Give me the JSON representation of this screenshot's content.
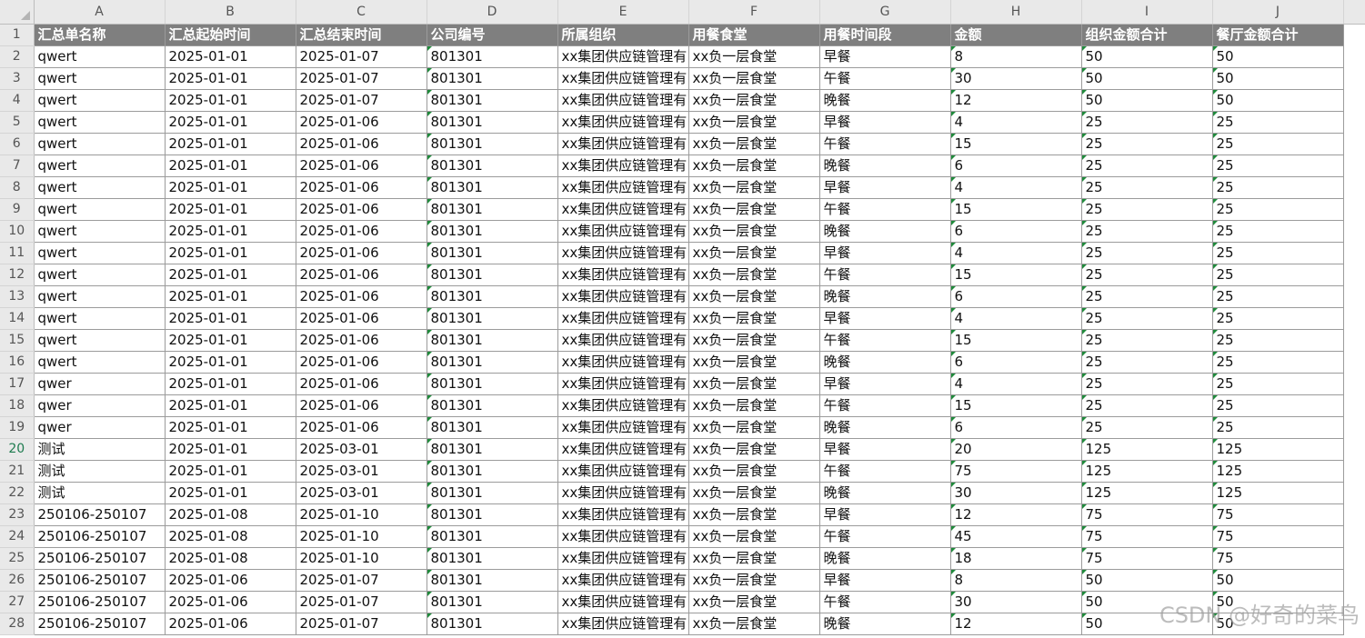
{
  "columns": [
    "A",
    "B",
    "C",
    "D",
    "E",
    "F",
    "G",
    "H",
    "I",
    "J"
  ],
  "headers": [
    "汇总单名称",
    "汇总起始时间",
    "汇总结束时间",
    "公司编号",
    "所属组织",
    "用餐食堂",
    "用餐时间段",
    "金额",
    "组织金额合计",
    "餐厅金额合计"
  ],
  "rows": [
    [
      "qwert",
      "2025-01-01",
      "2025-01-07",
      "801301",
      "xx集团供应链管理有",
      "xx负一层食堂",
      "早餐",
      "8",
      "50",
      "50"
    ],
    [
      "qwert",
      "2025-01-01",
      "2025-01-07",
      "801301",
      "xx集团供应链管理有",
      "xx负一层食堂",
      "午餐",
      "30",
      "50",
      "50"
    ],
    [
      "qwert",
      "2025-01-01",
      "2025-01-07",
      "801301",
      "xx集团供应链管理有",
      "xx负一层食堂",
      "晚餐",
      "12",
      "50",
      "50"
    ],
    [
      "qwert",
      "2025-01-01",
      "2025-01-06",
      "801301",
      "xx集团供应链管理有",
      "xx负一层食堂",
      "早餐",
      "4",
      "25",
      "25"
    ],
    [
      "qwert",
      "2025-01-01",
      "2025-01-06",
      "801301",
      "xx集团供应链管理有",
      "xx负一层食堂",
      "午餐",
      "15",
      "25",
      "25"
    ],
    [
      "qwert",
      "2025-01-01",
      "2025-01-06",
      "801301",
      "xx集团供应链管理有",
      "xx负一层食堂",
      "晚餐",
      "6",
      "25",
      "25"
    ],
    [
      "qwert",
      "2025-01-01",
      "2025-01-06",
      "801301",
      "xx集团供应链管理有",
      "xx负一层食堂",
      "早餐",
      "4",
      "25",
      "25"
    ],
    [
      "qwert",
      "2025-01-01",
      "2025-01-06",
      "801301",
      "xx集团供应链管理有",
      "xx负一层食堂",
      "午餐",
      "15",
      "25",
      "25"
    ],
    [
      "qwert",
      "2025-01-01",
      "2025-01-06",
      "801301",
      "xx集团供应链管理有",
      "xx负一层食堂",
      "晚餐",
      "6",
      "25",
      "25"
    ],
    [
      "qwert",
      "2025-01-01",
      "2025-01-06",
      "801301",
      "xx集团供应链管理有",
      "xx负一层食堂",
      "早餐",
      "4",
      "25",
      "25"
    ],
    [
      "qwert",
      "2025-01-01",
      "2025-01-06",
      "801301",
      "xx集团供应链管理有",
      "xx负一层食堂",
      "午餐",
      "15",
      "25",
      "25"
    ],
    [
      "qwert",
      "2025-01-01",
      "2025-01-06",
      "801301",
      "xx集团供应链管理有",
      "xx负一层食堂",
      "晚餐",
      "6",
      "25",
      "25"
    ],
    [
      "qwert",
      "2025-01-01",
      "2025-01-06",
      "801301",
      "xx集团供应链管理有",
      "xx负一层食堂",
      "早餐",
      "4",
      "25",
      "25"
    ],
    [
      "qwert",
      "2025-01-01",
      "2025-01-06",
      "801301",
      "xx集团供应链管理有",
      "xx负一层食堂",
      "午餐",
      "15",
      "25",
      "25"
    ],
    [
      "qwert",
      "2025-01-01",
      "2025-01-06",
      "801301",
      "xx集团供应链管理有",
      "xx负一层食堂",
      "晚餐",
      "6",
      "25",
      "25"
    ],
    [
      "qwer",
      "2025-01-01",
      "2025-01-06",
      "801301",
      "xx集团供应链管理有",
      "xx负一层食堂",
      "早餐",
      "4",
      "25",
      "25"
    ],
    [
      "qwer",
      "2025-01-01",
      "2025-01-06",
      "801301",
      "xx集团供应链管理有",
      "xx负一层食堂",
      "午餐",
      "15",
      "25",
      "25"
    ],
    [
      "qwer",
      "2025-01-01",
      "2025-01-06",
      "801301",
      "xx集团供应链管理有",
      "xx负一层食堂",
      "晚餐",
      "6",
      "25",
      "25"
    ],
    [
      "测试",
      "2025-01-01",
      "2025-03-01",
      "801301",
      "xx集团供应链管理有",
      "xx负一层食堂",
      "早餐",
      "20",
      "125",
      "125"
    ],
    [
      "测试",
      "2025-01-01",
      "2025-03-01",
      "801301",
      "xx集团供应链管理有",
      "xx负一层食堂",
      "午餐",
      "75",
      "125",
      "125"
    ],
    [
      "测试",
      "2025-01-01",
      "2025-03-01",
      "801301",
      "xx集团供应链管理有",
      "xx负一层食堂",
      "晚餐",
      "30",
      "125",
      "125"
    ],
    [
      "250106-250107",
      "2025-01-08",
      "2025-01-10",
      "801301",
      "xx集团供应链管理有",
      "xx负一层食堂",
      "早餐",
      "12",
      "75",
      "75"
    ],
    [
      "250106-250107",
      "2025-01-08",
      "2025-01-10",
      "801301",
      "xx集团供应链管理有",
      "xx负一层食堂",
      "午餐",
      "45",
      "75",
      "75"
    ],
    [
      "250106-250107",
      "2025-01-08",
      "2025-01-10",
      "801301",
      "xx集团供应链管理有",
      "xx负一层食堂",
      "晚餐",
      "18",
      "75",
      "75"
    ],
    [
      "250106-250107",
      "2025-01-06",
      "2025-01-07",
      "801301",
      "xx集团供应链管理有",
      "xx负一层食堂",
      "早餐",
      "8",
      "50",
      "50"
    ],
    [
      "250106-250107",
      "2025-01-06",
      "2025-01-07",
      "801301",
      "xx集团供应链管理有",
      "xx负一层食堂",
      "午餐",
      "30",
      "50",
      "50"
    ],
    [
      "250106-250107",
      "2025-01-06",
      "2025-01-07",
      "801301",
      "xx集团供应链管理有",
      "xx负一层食堂",
      "晚餐",
      "12",
      "50",
      "50"
    ]
  ],
  "selected_row": 20,
  "text_cols_with_indicator": [
    3,
    7,
    8,
    9
  ],
  "watermark": "CSDN @好奇的菜鸟",
  "colors": {
    "header_fill": "#7f7f7f",
    "indicator": "#1f8a3b",
    "row_header_selected": "#1e7b4f"
  }
}
